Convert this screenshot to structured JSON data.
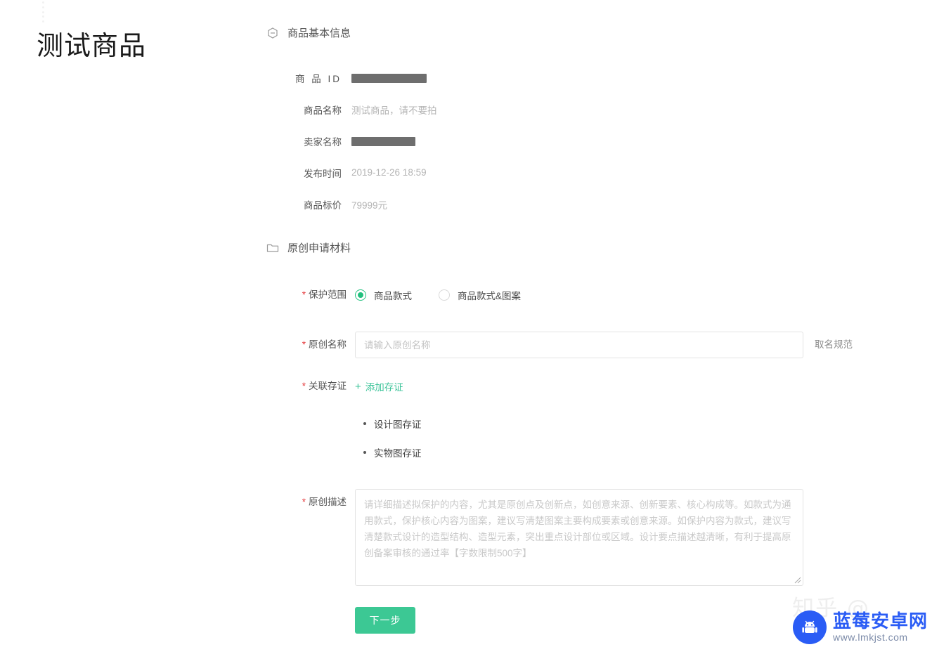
{
  "page": {
    "title": "测试商品"
  },
  "basic_section": {
    "icon": "hexagon-icon",
    "heading": "商品基本信息",
    "fields": [
      {
        "label": "商 品 ID",
        "value": "",
        "redacted": true
      },
      {
        "label": "商品名称",
        "value": "测试商品，请不要拍",
        "redacted": false
      },
      {
        "label": "卖家名称",
        "value": "",
        "redacted": true
      },
      {
        "label": "发布时间",
        "value": "2019-12-26 18:59",
        "redacted": false
      },
      {
        "label": "商品标价",
        "value": "79999元",
        "redacted": false
      }
    ]
  },
  "material_section": {
    "icon": "folder-icon",
    "heading": "原创申请材料",
    "scope": {
      "label": "保护范围",
      "required": true,
      "options": [
        {
          "label": "商品款式",
          "checked": true
        },
        {
          "label": "商品款式&图案",
          "checked": false
        }
      ]
    },
    "name_field": {
      "label": "原创名称",
      "required": true,
      "value": "",
      "placeholder": "请输入原创名称",
      "side_link": "取名规范"
    },
    "evidence": {
      "label": "关联存证",
      "required": true,
      "add_label": "添加存证",
      "add_icon": "plus-icon",
      "items": [
        "设计图存证",
        "实物图存证"
      ]
    },
    "description": {
      "label": "原创描述",
      "required": true,
      "value": "",
      "placeholder": "请详细描述拟保护的内容，尤其是原创点及创新点，如创意来源、创新要素、核心构成等。如款式为通用款式，保护核心内容为图案，建议写清楚图案主要构成要素或创意来源。如保护内容为款式，建议写清楚款式设计的造型结构、造型元素，突出重点设计部位或区域。设计要点描述越清晰，有利于提高原创备案审核的通过率【字数限制500字】"
    },
    "submit": {
      "label": "下一步"
    }
  },
  "watermarks": {
    "zhihu": "知乎 @",
    "site_name": "蓝莓安卓网",
    "site_url": "www.lmkjst.com"
  },
  "colors": {
    "accent_green": "#3cc894",
    "radio_green": "#22c07e",
    "required_red": "#e4393c",
    "watermark_blue": "#2a5cf5"
  }
}
